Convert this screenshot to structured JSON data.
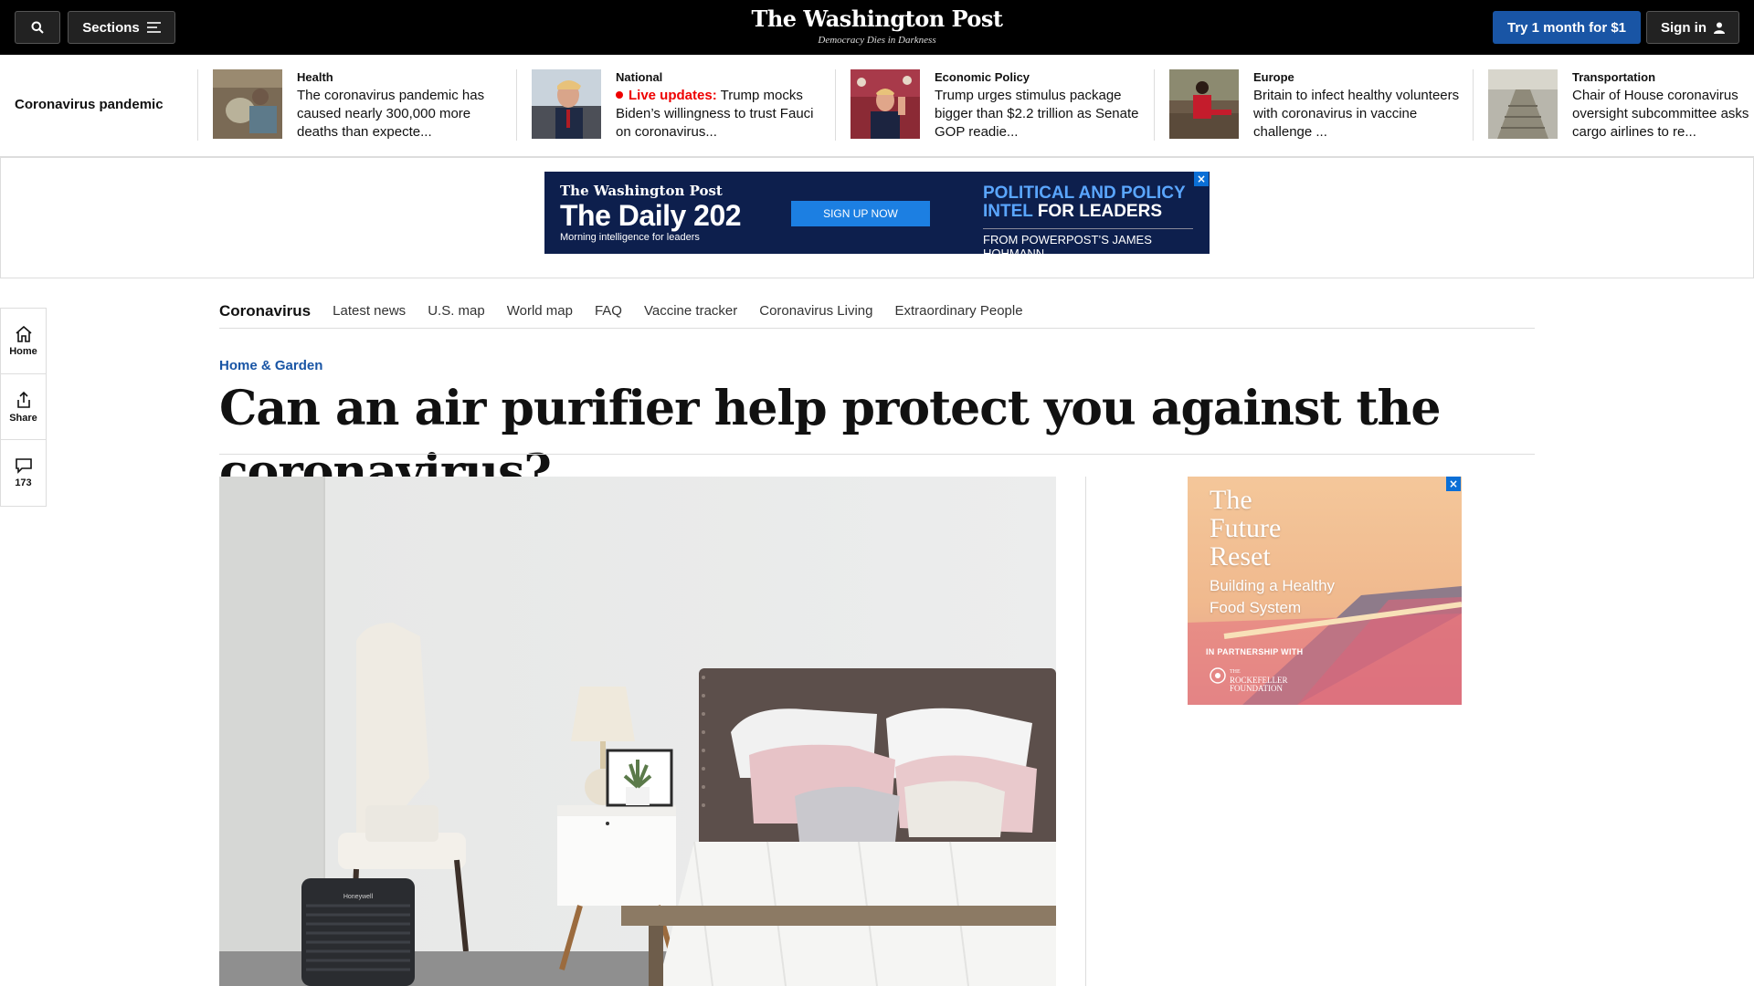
{
  "topbar": {
    "sections_label": "Sections",
    "brand_name": "The Washington Post",
    "brand_tagline": "Democracy Dies in Darkness",
    "try_label": "Try 1 month for $1",
    "signin_label": "Sign in"
  },
  "headlines": {
    "label": "Coronavirus pandemic",
    "items": [
      {
        "kicker": "Health",
        "text": "The coronavirus pandemic has caused nearly 300,000 more deaths than expecte..."
      },
      {
        "kicker": "National",
        "live": "Live updates:",
        "text": "Trump mocks Biden’s willingness to trust Fauci on coronavirus..."
      },
      {
        "kicker": "Economic Policy",
        "text": "Trump urges stimulus package bigger than $2.2 trillion as Senate GOP readie..."
      },
      {
        "kicker": "Europe",
        "text": "Britain to infect healthy volunteers with coronavirus in vaccine challenge ..."
      },
      {
        "kicker": "Transportation",
        "text": "Chair of House coronavirus oversight subcommittee asks cargo airlines to re..."
      }
    ]
  },
  "banner_ad": {
    "brand": "The Washington Post",
    "title": "The Daily 202",
    "subtitle": "Morning intelligence for leaders",
    "button": "SIGN UP NOW",
    "line1": "POLITICAL AND POLICY",
    "line2_a": "INTEL",
    "line2_b": " FOR LEADERS",
    "from": "FROM POWERPOST’S JAMES HOHMANN"
  },
  "subnav": {
    "title": "Coronavirus",
    "items": [
      "Latest news",
      "U.S. map",
      "World map",
      "FAQ",
      "Vaccine tracker",
      "Coronavirus Living",
      "Extraordinary People"
    ]
  },
  "rail": {
    "home": "Home",
    "share": "Share",
    "comments": "173"
  },
  "article": {
    "kicker": "Home & Garden",
    "headline": "Can an air purifier help protect you against the coronavirus?",
    "purifier_brand": "Honeywell"
  },
  "side_ad": {
    "title": "The Future Reset",
    "title_lines": [
      "The",
      "Future",
      "Reset"
    ],
    "subtitle_lines": [
      "Building a Healthy",
      "Food System"
    ],
    "partnership": "IN PARTNERSHIP WITH",
    "partner": "THE ROCKEFELLER FOUNDATION",
    "partner_lines": [
      "ROCKEFELLER",
      "FOUNDATION"
    ]
  },
  "colors": {
    "accent_blue": "#1955a5",
    "live_red": "#e00000",
    "topbar_bg": "#000000"
  }
}
